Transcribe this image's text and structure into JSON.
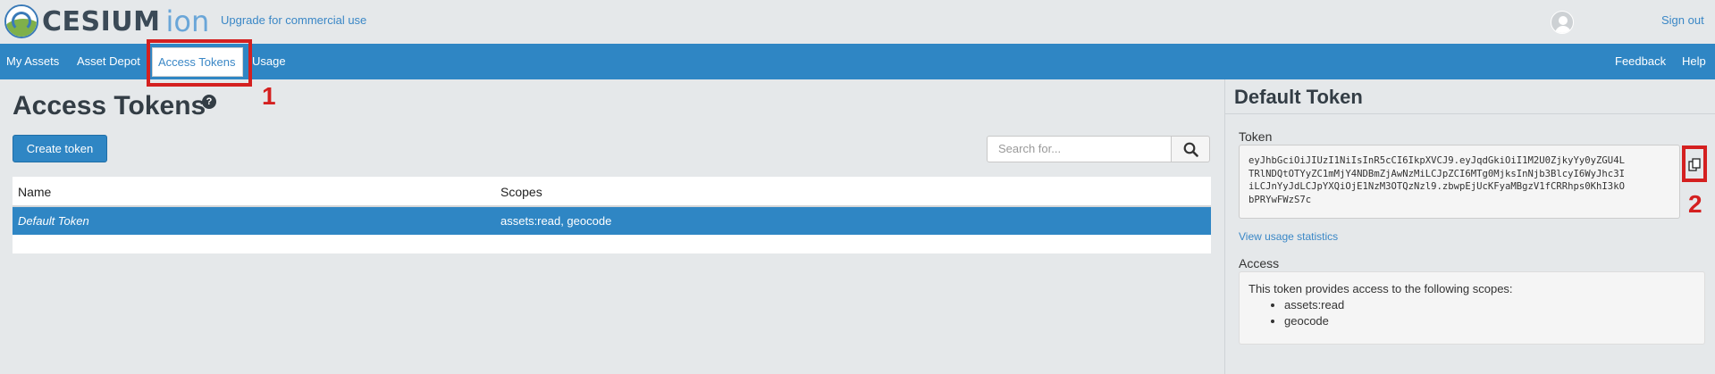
{
  "header": {
    "logo_text": "CESIUM",
    "logo_ion": "ion",
    "upgrade_link": "Upgrade for commercial use",
    "sign_out": "Sign out"
  },
  "nav": {
    "items": [
      "My Assets",
      "Asset Depot",
      "Access Tokens",
      "Usage"
    ],
    "active": "Access Tokens",
    "right_items": [
      "Feedback",
      "Help"
    ]
  },
  "annotations": {
    "one": "1",
    "two": "2"
  },
  "main": {
    "title": "Access Tokens",
    "help_glyph": "?",
    "create_button": "Create token",
    "search_placeholder": "Search for...",
    "table": {
      "headers": [
        "Name",
        "Scopes"
      ],
      "rows": [
        {
          "name": "Default Token",
          "scopes": "assets:read, geocode",
          "selected": true
        }
      ]
    }
  },
  "panel": {
    "title": "Default Token",
    "token_label": "Token",
    "token_lines": [
      "eyJhbGciOiJIUzI1NiIsInR5cCI6IkpXVCJ9.eyJqdGkiOiI1M2U0ZjkyYy0yZGU4L",
      "TRlNDQtOTYyZC1mMjY4NDBmZjAwNzMiLCJpZCI6MTg0MjksInNjb3BlcyI6WyJhc3I",
      "iLCJnYyJdLCJpYXQiOjE1NzM3OTQzNzl9.zbwpEjUcKFyaMBgzV1fCRRhps0KhI3kO",
      "bPRYwFWzS7c"
    ],
    "usage_link": "View usage statistics",
    "access_label": "Access",
    "access_text": "This token provides access to the following scopes:",
    "scopes": [
      "assets:read",
      "geocode"
    ]
  },
  "colors": {
    "nav_bg": "#2f86c4",
    "annotation_red": "#d42020",
    "link": "#3a87c6"
  },
  "icons": {
    "search": "search-icon",
    "copy": "copy-icon",
    "help": "help-icon",
    "avatar": "user-avatar"
  }
}
